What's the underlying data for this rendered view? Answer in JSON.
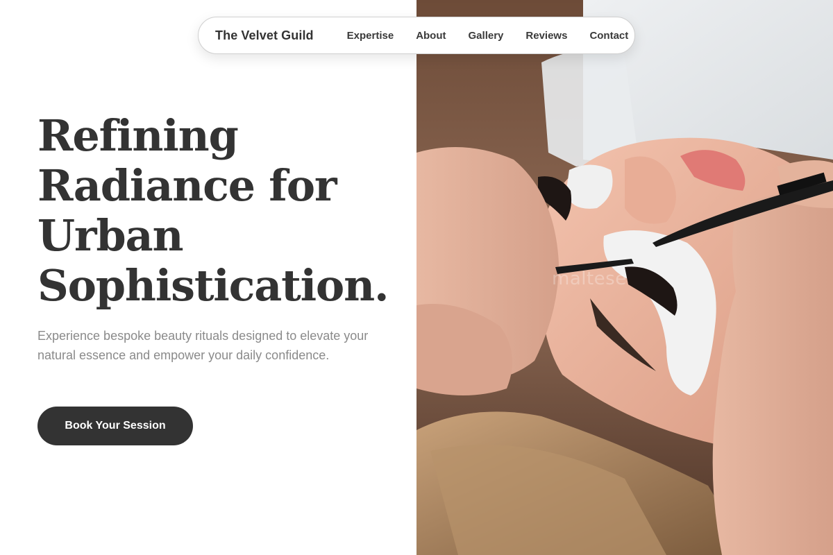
{
  "nav": {
    "brand": "The Velvet Guild",
    "links": [
      "Expertise",
      "About",
      "Gallery",
      "Reviews",
      "Contact"
    ]
  },
  "hero": {
    "title_lines": [
      "Refining",
      "Radiance for",
      "Urban",
      "Sophistication."
    ],
    "subtitle": "Experience bespoke beauty rituals designed to elevate your natural essence and empower your daily confidence.",
    "cta_label": "Book Your Session"
  },
  "image": {
    "watermark": "maltese"
  },
  "colors": {
    "text_dark": "#333333",
    "text_muted": "#8a8a8a",
    "button_bg": "#333333",
    "button_text": "#ffffff"
  }
}
